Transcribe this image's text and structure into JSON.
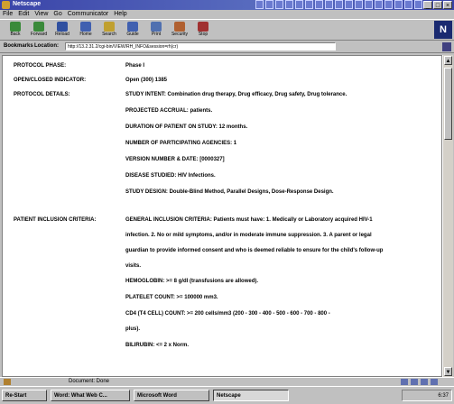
{
  "window": {
    "title": "Netscape"
  },
  "menu": [
    "File",
    "Edit",
    "View",
    "Go",
    "Communicator",
    "Help"
  ],
  "toolbar": {
    "buttons": [
      {
        "label": "Back",
        "icon": "back-arrow-icon",
        "color": "#3a8a3a"
      },
      {
        "label": "Forward",
        "icon": "forward-arrow-icon",
        "color": "#3a8a3a"
      },
      {
        "label": "Reload",
        "icon": "reload-icon",
        "color": "#3050a0"
      },
      {
        "label": "Home",
        "icon": "home-icon",
        "color": "#4060b0"
      },
      {
        "label": "Search",
        "icon": "search-icon",
        "color": "#c0a030"
      },
      {
        "label": "Guide",
        "icon": "guide-icon",
        "color": "#4060b0"
      },
      {
        "label": "Print",
        "icon": "print-icon",
        "color": "#5070b0"
      },
      {
        "label": "Security",
        "icon": "lock-icon",
        "color": "#b06030"
      },
      {
        "label": "Stop",
        "icon": "stop-icon",
        "color": "#a03030"
      }
    ]
  },
  "location": {
    "bookmarks_label": "Bookmarks",
    "label": "Location:",
    "url": "http://13.2.31.2/cgi-bin/VIEW/RH_INFO&session=rh(cr)"
  },
  "protocol": [
    {
      "key": "PROTOCOL PHASE:",
      "values": [
        "Phase I"
      ]
    },
    {
      "key": "OPEN/CLOSED INDICATOR:",
      "values": [
        "Open (300) 1385"
      ]
    },
    {
      "key": "PROTOCOL DETAILS:",
      "values": [
        "STUDY INTENT: Combination drug therapy, Drug efficacy, Drug safety, Drug tolerance.",
        "PROJECTED ACCRUAL: patients.",
        "DURATION OF PATIENT ON STUDY: 12 months.",
        "NUMBER OF PARTICIPATING AGENCIES: 1",
        "VERSION NUMBER & DATE: [0000327]",
        "DISEASE STUDIED: HIV Infections.",
        "STUDY DESIGN: Double-Blind Method, Parallel Designs, Dose-Response Design."
      ]
    },
    {
      "key": "PATIENT INCLUSION CRITERIA:",
      "values": [
        "GENERAL INCLUSION CRITERIA: Patients must have: 1. Medically or Laboratory acquired HIV-1",
        "infection. 2. No or mild symptoms, and/or in moderate immune suppression. 3. A parent or legal",
        "guardian to provide informed consent and who is deemed reliable to ensure for the child's follow-up",
        "visits.",
        "HEMOGLOBIN: >= 8 g/dl (transfusions are allowed).",
        "PLATELET COUNT: >= 100000 mm3.",
        "CD4 (T4 CELL) COUNT: >= 200 cells/mm3 (200 - 300 - 400 - 500 - 600 - 700 - 800 -",
        "plus).",
        "BILIRUBIN: <= 2 x Norm."
      ]
    }
  ],
  "status": {
    "message": "Document: Done"
  },
  "taskbar": {
    "tasks": [
      "Re-Start",
      "Word: What Web C...",
      "Microsoft Word",
      "Netscape"
    ],
    "clock": "6:37"
  }
}
